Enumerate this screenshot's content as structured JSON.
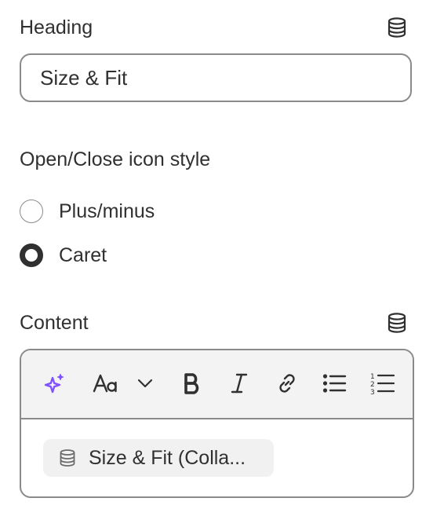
{
  "heading": {
    "label": "Heading",
    "value": "Size & Fit",
    "dynamic_source_icon": "database-icon"
  },
  "icon_style": {
    "label": "Open/Close icon style",
    "options": [
      {
        "label": "Plus/minus",
        "checked": false
      },
      {
        "label": "Caret",
        "checked": true
      }
    ]
  },
  "content": {
    "label": "Content",
    "dynamic_source_icon": "database-icon",
    "toolbar": {
      "buttons": [
        {
          "name": "ai-sparkle",
          "icon": "sparkle-icon",
          "color": "#8051ff"
        },
        {
          "name": "text-style",
          "icon": "font-size-icon"
        },
        {
          "name": "text-style-dropdown",
          "icon": "chevron-down-icon"
        },
        {
          "name": "bold",
          "icon": "bold-icon"
        },
        {
          "name": "italic",
          "icon": "italic-icon"
        },
        {
          "name": "link",
          "icon": "link-icon"
        },
        {
          "name": "bulleted-list",
          "icon": "bullet-list-icon"
        },
        {
          "name": "numbered-list",
          "icon": "numbered-list-icon"
        }
      ]
    },
    "dynamic_chip": {
      "text": "Size & Fit (Colla...",
      "icon": "database-icon"
    }
  },
  "colors": {
    "text": "#303030",
    "border": "#8a8a8a",
    "accent_purple": "#8051ff",
    "toolbar_bg": "#f3f3f3",
    "chip_bg": "#f1f1f1"
  }
}
